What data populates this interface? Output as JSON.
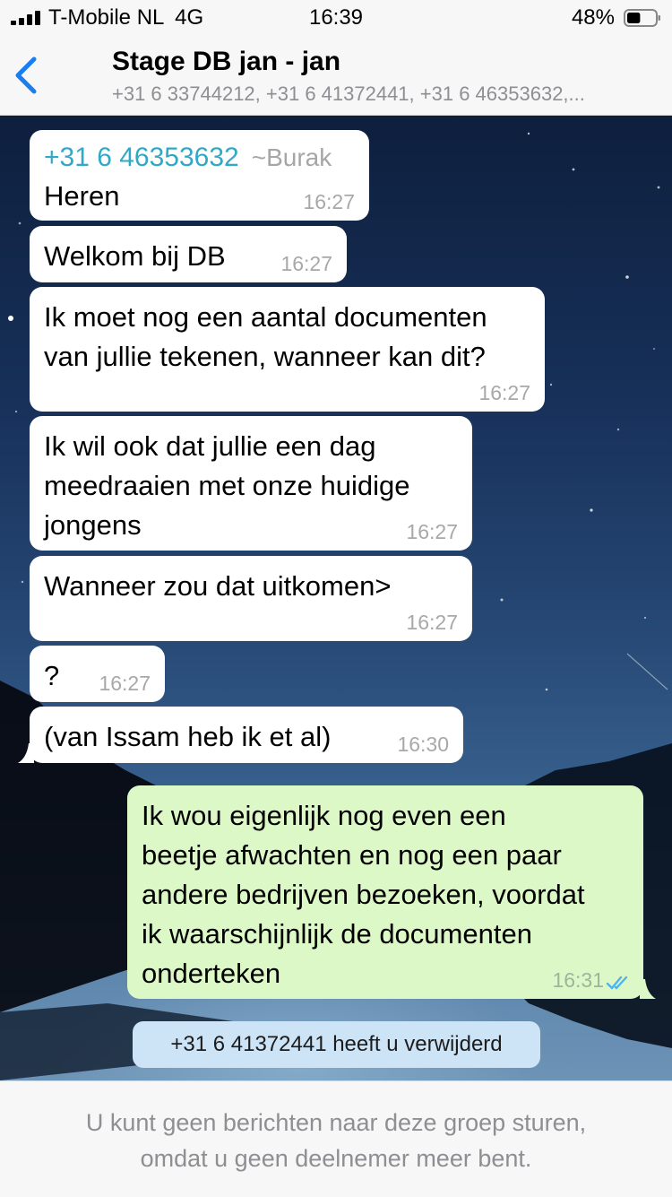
{
  "status_bar": {
    "carrier": "T-Mobile NL",
    "network": "4G",
    "time": "16:39",
    "battery_percent": "48%",
    "battery_level": 0.48
  },
  "header": {
    "back_icon": "chevron-left-icon",
    "title": "Stage DB jan - jan",
    "subtitle": "+31 6 33744212, +31 6 41372441, +31 6 46353632,..."
  },
  "messages": [
    {
      "direction": "in",
      "sender": "+31 6 46353632",
      "sender_alias": "~Burak",
      "text": "Heren",
      "time": "16:27"
    },
    {
      "direction": "in",
      "text": "Welkom bij DB",
      "time": "16:27"
    },
    {
      "direction": "in",
      "text": "Ik moet nog een aantal documenten\nvan jullie tekenen, wanneer kan dit?",
      "time": "16:27"
    },
    {
      "direction": "in",
      "text": "Ik wil ook dat jullie een dag\nmeedraaien met onze huidige\njongens",
      "time": "16:27"
    },
    {
      "direction": "in",
      "text": "Wanneer zou dat uitkomen>",
      "time": "16:27"
    },
    {
      "direction": "in",
      "text": "?",
      "time": "16:27"
    },
    {
      "direction": "in",
      "text": "(van Issam heb ik et al)",
      "time": "16:30"
    },
    {
      "direction": "out",
      "text": "Ik wou eigenlijk nog even een\nbeetje afwachten en nog een paar\nandere bedrijven bezoeken, voordat\nik waarschijnlijk de documenten\nonderteken",
      "time": "16:31",
      "status": "read"
    }
  ],
  "system_message": "+31 6 41372441 heeft u verwijderd",
  "footer_notice": "U kunt geen berichten naar deze groep sturen,\nomdat u geen deelnemer meer bent.",
  "colors": {
    "accent": "#1a7ef2",
    "incoming_bubble": "#ffffff",
    "outgoing_bubble": "#dcf8c6",
    "sender_name": "#2fa9c6",
    "system_bubble": "#cde4f7",
    "read_ticks": "#4fb3f0"
  }
}
